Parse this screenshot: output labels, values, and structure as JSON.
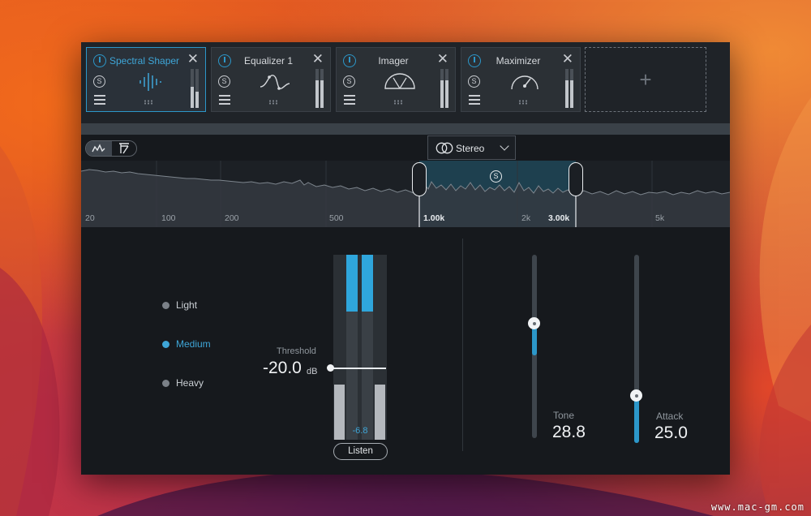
{
  "modules": [
    {
      "name": "Spectral Shaper",
      "active": true,
      "graphic": "spectral-bars"
    },
    {
      "name": "Equalizer 1",
      "active": false,
      "graphic": "eq-curve"
    },
    {
      "name": "Imager",
      "active": false,
      "graphic": "imager-arc"
    },
    {
      "name": "Maximizer",
      "active": false,
      "graphic": "gauge"
    }
  ],
  "solo_glyph": "S",
  "add_glyph": "+",
  "close_glyph": "✕",
  "toolbar": {
    "channel_mode": "Stereo"
  },
  "spectrum": {
    "freq_labels": [
      "20",
      "100",
      "200",
      "500",
      "1.00k",
      "2k",
      "3.00k",
      "5k"
    ],
    "band": {
      "low": "1.00k",
      "high": "3.00k"
    },
    "band_solo_glyph": "S"
  },
  "modes": {
    "light": "Light",
    "medium": "Medium",
    "heavy": "Heavy",
    "selected": "Medium"
  },
  "threshold": {
    "title": "Threshold",
    "value": "-20.0",
    "unit": "dB"
  },
  "meter": {
    "readout": "-6.8",
    "listen_label": "Listen"
  },
  "tone": {
    "label": "Tone",
    "value": "28.8"
  },
  "attack": {
    "label": "Attack",
    "value": "25.0"
  },
  "colors": {
    "accent": "#2c97c9",
    "panel": "#16191d"
  },
  "watermark": "www.mac-gm.com"
}
